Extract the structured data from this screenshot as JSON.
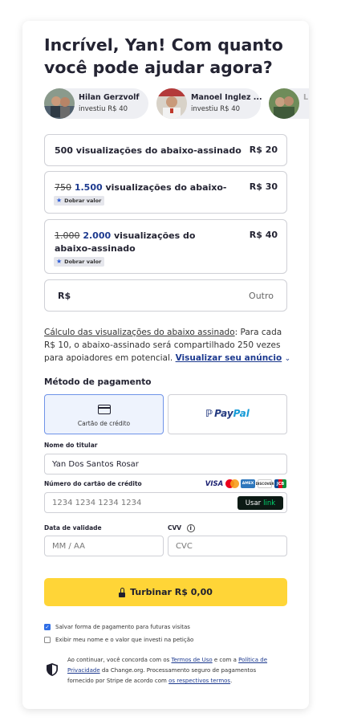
{
  "header": {
    "title": "Incrível, Yan! Com quanto você pode ajudar agora?"
  },
  "supporters": [
    {
      "name": "Hilan Gerzvolf",
      "action": "investiu R$ 40"
    },
    {
      "name": "Manoel Inglez ...",
      "action": "investiu R$ 40"
    },
    {
      "name": "L",
      "action": ""
    }
  ],
  "options": [
    {
      "old": "",
      "new": "",
      "label": "500 visualizações do abaixo-assinado",
      "price": "R$ 20",
      "badge": ""
    },
    {
      "old": "750",
      "new": "1.500",
      "label": "visualizações do abaixo-assinado",
      "price": "R$ 30",
      "badge": "Dobrar valor"
    },
    {
      "old": "1.000",
      "new": "2.000",
      "label": "visualizações do abaixo-assinado",
      "price": "R$ 40",
      "badge": "Dobrar valor"
    }
  ],
  "custom": {
    "currency": "R$",
    "other": "Outro"
  },
  "calc": {
    "link_text": "Cálculo das visualizações do abaixo assinado",
    "text": ": Para cada R$ 10, o abaixo-assinado será compartilhado 250 vezes para apoiadores em potencial.",
    "preview_link": "Visualizar seu anúncio",
    "chevron": "⌄"
  },
  "payment": {
    "section_title": "Método de pagamento",
    "card_label": "Cartão de crédito",
    "paypal_p1": "Pay",
    "paypal_p2": "Pal"
  },
  "form": {
    "holder_label": "Nome do titular",
    "holder_value": "Yan Dos Santos Rosar",
    "card_label": "Número do cartão de crédito",
    "card_placeholder": "1234 1234 1234 1234",
    "link_label": "Usar",
    "link_brand": "link",
    "expiry_label": "Data de validade",
    "expiry_placeholder": "MM / AA",
    "cvv_label": "CVV",
    "cvv_placeholder": "CVC",
    "brands": {
      "visa": "VISA",
      "amex": "AMEX",
      "discover": "DISCOVER",
      "jcb": "JCB"
    }
  },
  "submit": {
    "label": "Turbinar R$ 0,00"
  },
  "checkboxes": [
    {
      "label": "Salvar forma de pagamento para futuras visitas",
      "checked": true
    },
    {
      "label": "Exibir meu nome e o valor que investi na petição",
      "checked": false
    }
  ],
  "terms": {
    "t1": "Ao continuar, você concorda com os ",
    "l1": "Termos de Uso",
    "t2": " e com a ",
    "l2": "Política de Privacidade",
    "t3": " da Change.org. Processamento seguro de pagamentos fornecido por Stripe de acordo com ",
    "l3": "os respectivos termos",
    "t4": "."
  },
  "colors": {
    "accent": "#1d3a8f",
    "cta": "#ffd537",
    "selected_bg": "#eef3fd",
    "selected_border": "#6f93e8"
  }
}
